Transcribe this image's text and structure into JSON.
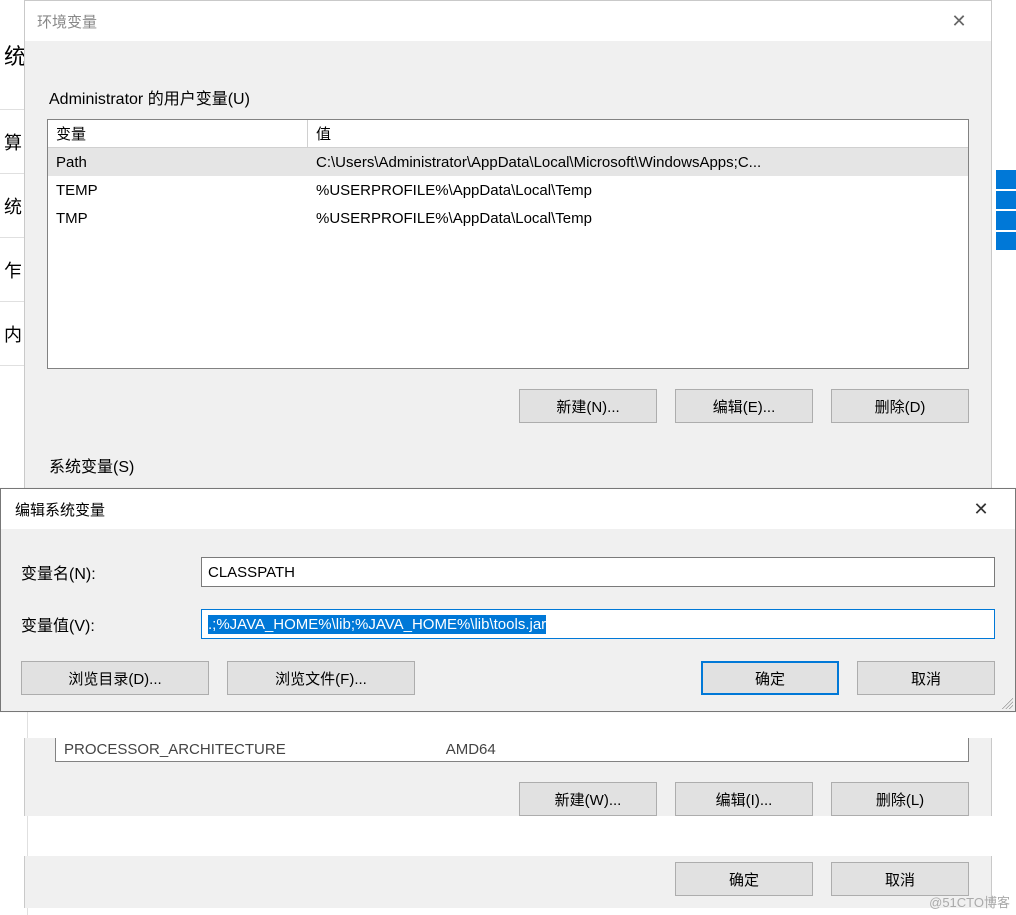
{
  "bg": {
    "cells": [
      "统",
      "算",
      "统",
      "乍",
      "内"
    ]
  },
  "env": {
    "title": "环境变量",
    "user_label": "Administrator 的用户变量(U)",
    "headers": {
      "name": "变量",
      "value": "值"
    },
    "user_rows": [
      {
        "name": "Path",
        "value": "C:\\Users\\Administrator\\AppData\\Local\\Microsoft\\WindowsApps;C..."
      },
      {
        "name": "TEMP",
        "value": "%USERPROFILE%\\AppData\\Local\\Temp"
      },
      {
        "name": "TMP",
        "value": "%USERPROFILE%\\AppData\\Local\\Temp"
      }
    ],
    "user_buttons": {
      "new": "新建(N)...",
      "edit": "编辑(E)...",
      "delete": "删除(D)"
    },
    "sys_label": "系统变量(S)",
    "sys_cut": {
      "name": "PROCESSOR_ARCHITECTURE",
      "value": "AMD64"
    },
    "sys_buttons": {
      "new": "新建(W)...",
      "edit": "编辑(I)...",
      "delete": "删除(L)"
    },
    "footer": {
      "ok": "确定",
      "cancel": "取消"
    }
  },
  "edit": {
    "title": "编辑系统变量",
    "name_label": "变量名(N):",
    "name_value": "CLASSPATH",
    "value_label": "变量值(V):",
    "value_value": ".;%JAVA_HOME%\\lib;%JAVA_HOME%\\lib\\tools.jar",
    "buttons": {
      "browse_dir": "浏览目录(D)...",
      "browse_file": "浏览文件(F)...",
      "ok": "确定",
      "cancel": "取消"
    }
  },
  "watermark": "@51CTO博客"
}
